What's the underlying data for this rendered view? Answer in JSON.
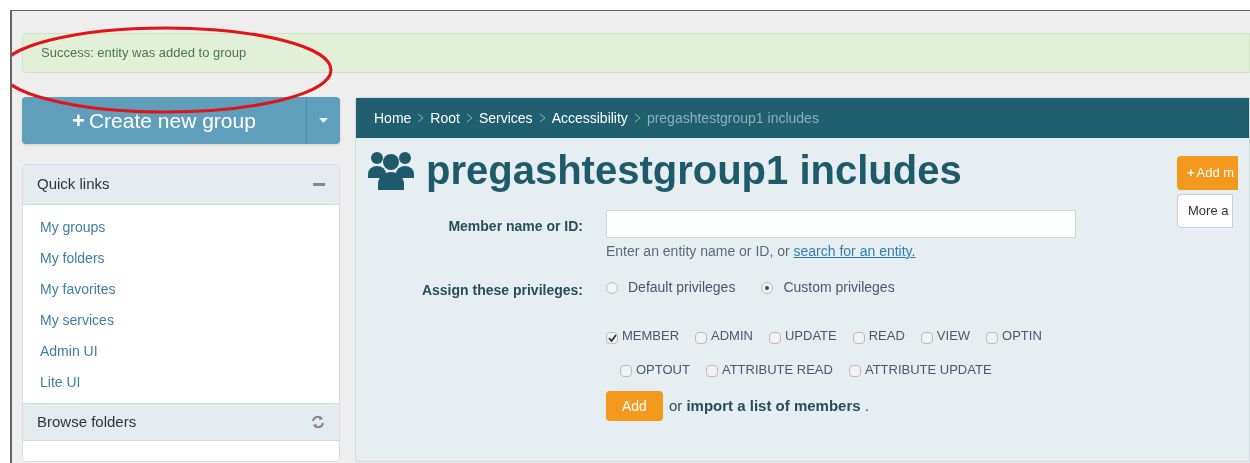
{
  "alert": {
    "text": "Success: entity was added to group"
  },
  "create_button": {
    "icon": "+",
    "label": "Create new group"
  },
  "quick_links": {
    "title": "Quick links",
    "items": [
      "My groups",
      "My folders",
      "My favorites",
      "My services",
      "Admin UI",
      "Lite UI"
    ]
  },
  "browse_folders": {
    "title": "Browse folders"
  },
  "breadcrumb": [
    {
      "label": "Home",
      "current": false
    },
    {
      "label": "Root",
      "current": false
    },
    {
      "label": "Services",
      "current": false
    },
    {
      "label": "Accessibility",
      "current": false
    },
    {
      "label": "pregashtestgroup1 includes",
      "current": true
    }
  ],
  "heading": "pregashtestgroup1 includes",
  "actions": [
    {
      "kind": "primary",
      "icon": "+",
      "label": "Add m"
    },
    {
      "kind": "default",
      "label": "More a"
    }
  ],
  "form": {
    "member_label": "Member name or ID:",
    "help_text": "Enter an entity name or ID, or ",
    "help_link": "search for an entity.",
    "privileges_label": "Assign these privileges:",
    "radios": [
      {
        "label": "Default privileges",
        "selected": false
      },
      {
        "label": "Custom privileges",
        "selected": true
      }
    ],
    "checkboxes": [
      {
        "label": "MEMBER",
        "checked": true
      },
      {
        "label": "ADMIN",
        "checked": false
      },
      {
        "label": "UPDATE",
        "checked": false
      },
      {
        "label": "READ",
        "checked": false
      },
      {
        "label": "VIEW",
        "checked": false
      },
      {
        "label": "OPTIN",
        "checked": false
      },
      {
        "label": "OPTOUT",
        "checked": false
      },
      {
        "label": "ATTRIBUTE READ",
        "checked": false
      },
      {
        "label": "ATTRIBUTE UPDATE",
        "checked": false
      }
    ],
    "add_button": "Add",
    "import_text": "or **import a list of members** ."
  }
}
